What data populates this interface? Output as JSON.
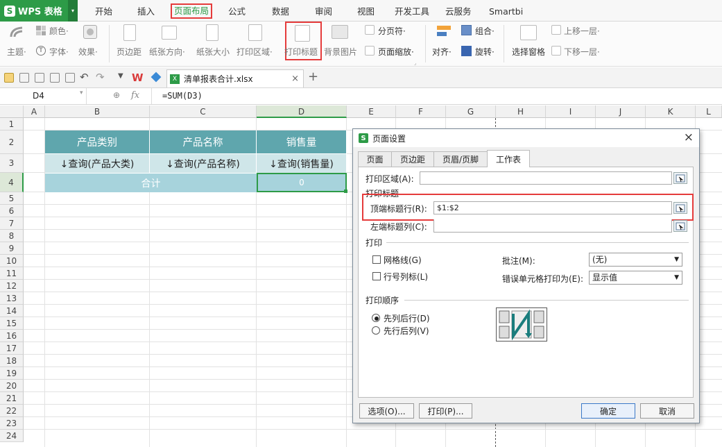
{
  "app": {
    "logo_letter": "S",
    "logo_text": "WPS 表格"
  },
  "menu": {
    "items": [
      "开始",
      "插入",
      "页面布局",
      "公式",
      "数据",
      "审阅",
      "视图",
      "开发工具",
      "云服务",
      "Smartbi"
    ],
    "active": "页面布局"
  },
  "ribbon": {
    "theme": "主题·",
    "color": "颜色·",
    "font": "字体·",
    "effect": "效果·",
    "margin": "页边距",
    "orientation": "纸张方向·",
    "size": "纸张大小",
    "print_area": "打印区域·",
    "print_titles": "打印标题",
    "background": "背景图片",
    "page_break": "分页符·",
    "page_scale": "页面缩放·",
    "align": "对齐·",
    "group": "组合·",
    "rotate": "旋转·",
    "selection_pane": "选择窗格",
    "bring_forward": "上移一层·",
    "send_backward": "下移一层·"
  },
  "document": {
    "tab_name": "清单报表合计.xlsx",
    "close": "×",
    "add": "+"
  },
  "formula_bar": {
    "name_box": "D4",
    "fx": "fx",
    "formula": "=SUM(D3)"
  },
  "grid": {
    "columns": [
      "A",
      "B",
      "C",
      "D",
      "E",
      "F",
      "G",
      "H",
      "I",
      "J",
      "K",
      "L"
    ],
    "rows": [
      "1",
      "2",
      "3",
      "4",
      "5",
      "6",
      "7",
      "8",
      "9",
      "10",
      "11",
      "12",
      "13",
      "14",
      "15",
      "16",
      "17",
      "18",
      "19",
      "20",
      "21",
      "22",
      "23",
      "24"
    ],
    "header_row": [
      "产品类别",
      "产品名称",
      "销售量"
    ],
    "query_row": [
      "↓查询(产品大类)",
      "↓查询(产品名称)",
      "↓查询(销售量)"
    ],
    "total_label": "合计",
    "total_value": "0"
  },
  "dialog": {
    "logo_letter": "S",
    "title": "页面设置",
    "close": "×",
    "tabs": [
      "页面",
      "页边距",
      "页眉/页脚",
      "工作表"
    ],
    "active_tab": "工作表",
    "print_area_label": "打印区域(A):",
    "print_area_value": "",
    "print_titles_group": "打印标题",
    "top_rows_label": "顶端标题行(R):",
    "top_rows_value": "$1:$2",
    "left_cols_label": "左端标题列(C):",
    "left_cols_value": "",
    "print_group": "打印",
    "gridlines_label": "网格线(G)",
    "row_col_headers_label": "行号列标(L)",
    "comments_label": "批注(M):",
    "comments_value": "(无)",
    "errors_label": "错误单元格打印为(E):",
    "errors_value": "显示值",
    "order_group": "打印顺序",
    "down_then_over": "先列后行(D)",
    "over_then_down": "先行后列(V)",
    "options_btn": "选项(O)...",
    "print_btn": "打印(P)...",
    "ok_btn": "确定",
    "cancel_btn": "取消"
  },
  "colors": {
    "accent": "#2d9b47",
    "highlight": "#e53b3b",
    "table_header": "#5fa6ad",
    "table_query": "#cfe6e9",
    "table_total": "#a7d3dc"
  }
}
